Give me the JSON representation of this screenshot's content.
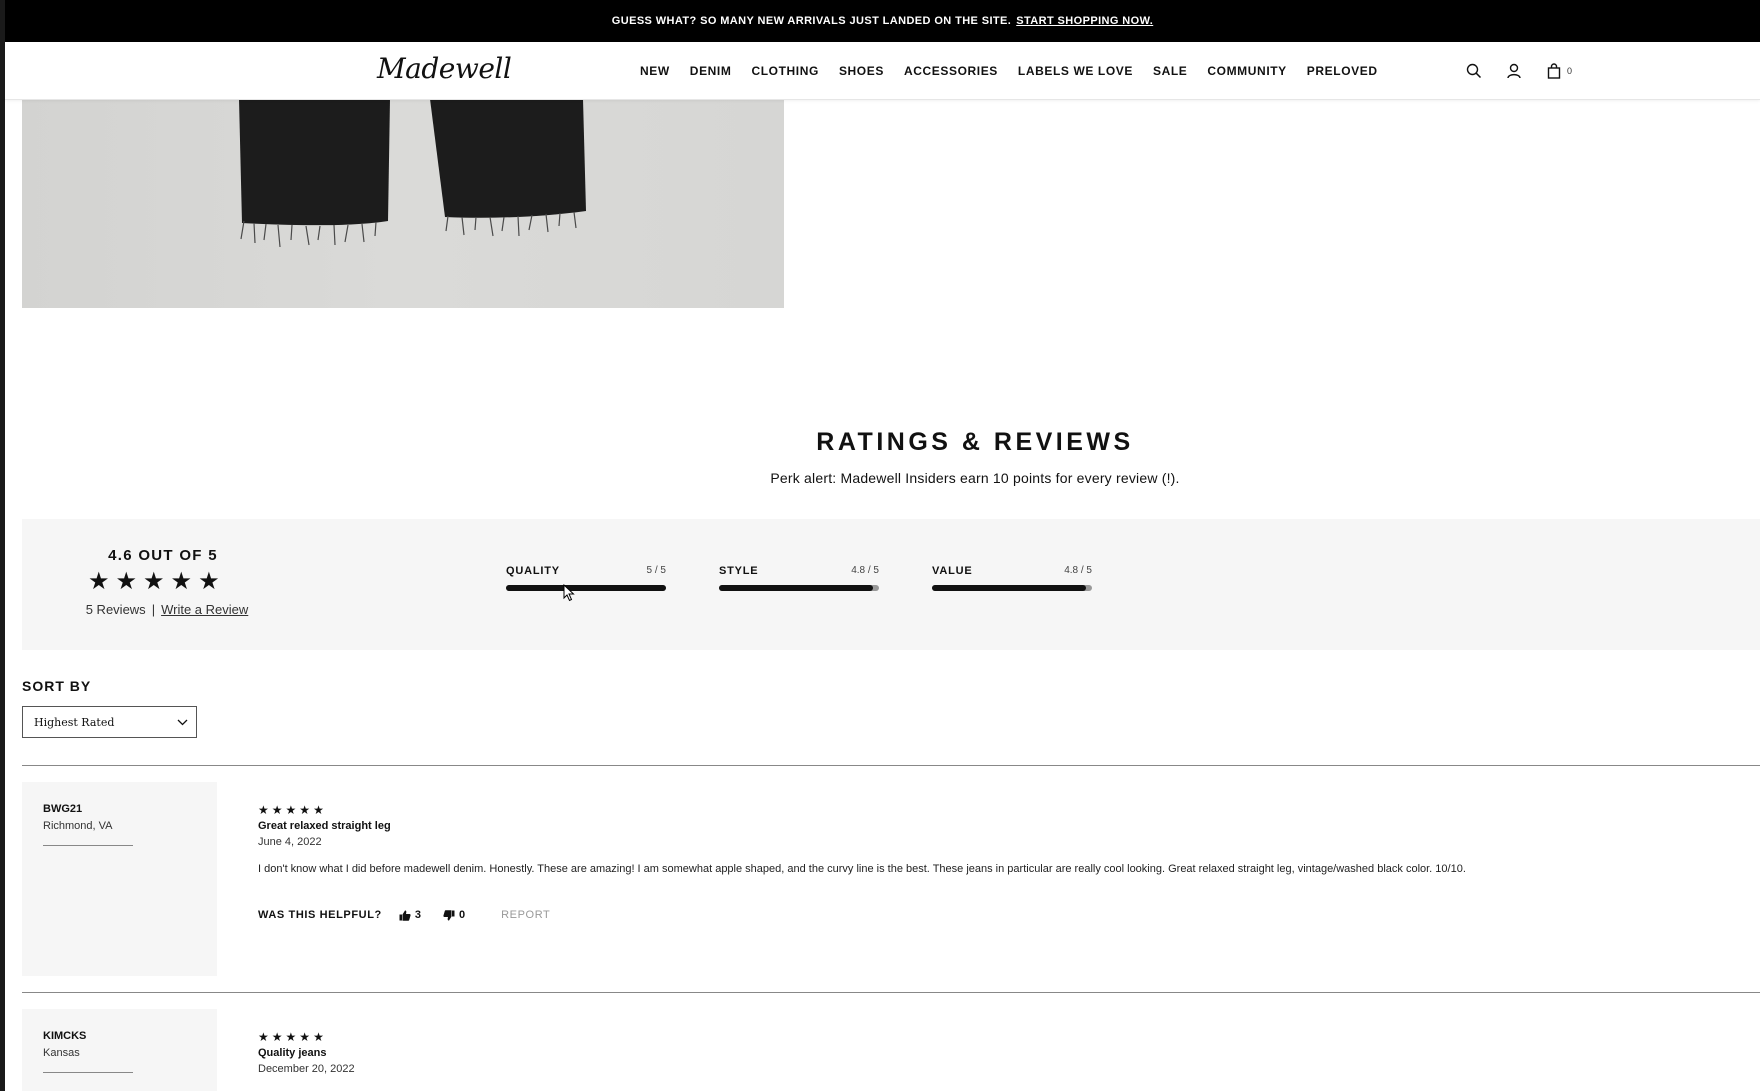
{
  "promo": {
    "text": "GUESS WHAT? SO MANY NEW ARRIVALS JUST LANDED ON THE SITE.",
    "link": "START SHOPPING NOW."
  },
  "header": {
    "logo": "Madewell",
    "nav": [
      "NEW",
      "DENIM",
      "CLOTHING",
      "SHOES",
      "ACCESSORIES",
      "LABELS WE LOVE",
      "SALE",
      "COMMUNITY",
      "PRELOVED"
    ],
    "bag_count": "0",
    "icons": [
      "search-icon",
      "account-icon",
      "bag-icon"
    ]
  },
  "reviews_section": {
    "title": "RATINGS & REVIEWS",
    "perk": "Perk alert: Madewell Insiders earn 10 points for every review (!)."
  },
  "summary": {
    "average": "4.6 OUT OF 5",
    "stars": 5,
    "count": "5 Reviews",
    "separator": "|",
    "write_review": "Write a Review",
    "metrics": [
      {
        "label": "QUALITY",
        "value": "5 / 5",
        "fraction": 1.0
      },
      {
        "label": "STYLE",
        "value": "4.8 / 5",
        "fraction": 0.96
      },
      {
        "label": "VALUE",
        "value": "4.8 / 5",
        "fraction": 0.96
      }
    ]
  },
  "sort": {
    "label": "SORT BY",
    "selected": "Highest Rated"
  },
  "reviews": [
    {
      "name": "BWG21",
      "location": "Richmond, VA",
      "stars": 5,
      "title": "Great relaxed straight leg",
      "date": "June 4, 2022",
      "body": "I don't know what I did before madewell denim. Honestly. These are amazing! I am somewhat apple shaped, and the curvy line is the best. These jeans in particular are really cool looking. Great relaxed straight leg, vintage/washed black color. 10/10.",
      "helpful_label": "WAS THIS HELPFUL?",
      "up": "3",
      "down": "0",
      "report": "REPORT"
    },
    {
      "name": "KIMCKS",
      "location": "Kansas",
      "stars": 5,
      "title": "Quality jeans",
      "date": "December 20, 2022"
    }
  ]
}
